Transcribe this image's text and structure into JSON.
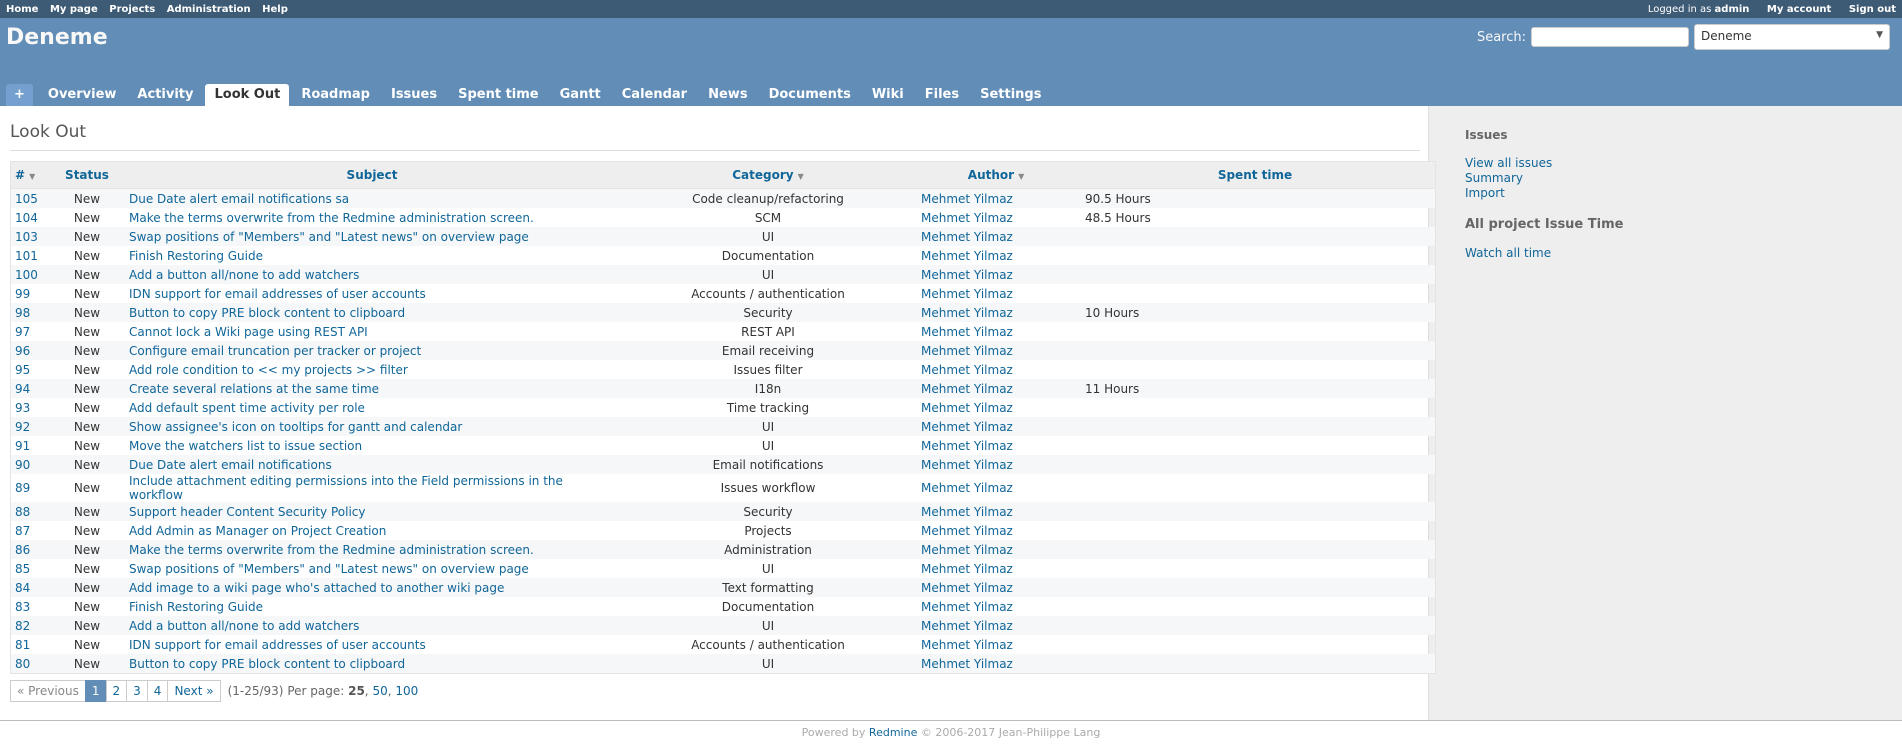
{
  "top_menu": {
    "left": [
      "Home",
      "My page",
      "Projects",
      "Administration",
      "Help"
    ],
    "logged_prefix": "Logged in as",
    "logged_user": "admin",
    "my_account": "My account",
    "sign_out": "Sign out"
  },
  "header": {
    "project_title": "Deneme",
    "search_label": "Search:",
    "search_value": "",
    "project_jump": "Deneme"
  },
  "tabs": [
    "+",
    "Overview",
    "Activity",
    "Look Out",
    "Roadmap",
    "Issues",
    "Spent time",
    "Gantt",
    "Calendar",
    "News",
    "Documents",
    "Wiki",
    "Files",
    "Settings"
  ],
  "selected_tab": "Look Out",
  "page_title": "Look Out",
  "table": {
    "headers": {
      "id": "#",
      "status": "Status",
      "subject": "Subject",
      "category": "Category",
      "author": "Author",
      "spent": "Spent time"
    },
    "rows": [
      {
        "id": "105",
        "status": "New",
        "subject": "Due Date alert email notifications sa",
        "category": "Code cleanup/refactoring",
        "author": "Mehmet Yilmaz",
        "spent": "90.5 Hours"
      },
      {
        "id": "104",
        "status": "New",
        "subject": "Make the terms overwrite from the Redmine administration screen.",
        "category": "SCM",
        "author": "Mehmet Yilmaz",
        "spent": "48.5 Hours"
      },
      {
        "id": "103",
        "status": "New",
        "subject": "Swap positions of \"Members\" and \"Latest news\" on overview page",
        "category": "UI",
        "author": "Mehmet Yilmaz",
        "spent": ""
      },
      {
        "id": "101",
        "status": "New",
        "subject": "Finish Restoring Guide",
        "category": "Documentation",
        "author": "Mehmet Yilmaz",
        "spent": ""
      },
      {
        "id": "100",
        "status": "New",
        "subject": "Add a button all/none to add watchers",
        "category": "UI",
        "author": "Mehmet Yilmaz",
        "spent": ""
      },
      {
        "id": "99",
        "status": "New",
        "subject": "IDN support for email addresses of user accounts",
        "category": "Accounts / authentication",
        "author": "Mehmet Yilmaz",
        "spent": ""
      },
      {
        "id": "98",
        "status": "New",
        "subject": "Button to copy PRE block content to clipboard",
        "category": "Security",
        "author": "Mehmet Yilmaz",
        "spent": "10 Hours"
      },
      {
        "id": "97",
        "status": "New",
        "subject": "Cannot lock a Wiki page using REST API",
        "category": "REST API",
        "author": "Mehmet Yilmaz",
        "spent": ""
      },
      {
        "id": "96",
        "status": "New",
        "subject": "Configure email truncation per tracker or project",
        "category": "Email receiving",
        "author": "Mehmet Yilmaz",
        "spent": ""
      },
      {
        "id": "95",
        "status": "New",
        "subject": "Add role condition to << my projects >> filter",
        "category": "Issues filter",
        "author": "Mehmet Yilmaz",
        "spent": ""
      },
      {
        "id": "94",
        "status": "New",
        "subject": "Create several relations at the same time",
        "category": "I18n",
        "author": "Mehmet Yilmaz",
        "spent": "11 Hours"
      },
      {
        "id": "93",
        "status": "New",
        "subject": "Add default spent time activity per role",
        "category": "Time tracking",
        "author": "Mehmet Yilmaz",
        "spent": ""
      },
      {
        "id": "92",
        "status": "New",
        "subject": "Show assignee's icon on tooltips for gantt and calendar",
        "category": "UI",
        "author": "Mehmet Yilmaz",
        "spent": ""
      },
      {
        "id": "91",
        "status": "New",
        "subject": "Move the watchers list to issue section",
        "category": "UI",
        "author": "Mehmet Yilmaz",
        "spent": ""
      },
      {
        "id": "90",
        "status": "New",
        "subject": "Due Date alert email notifications",
        "category": "Email notifications",
        "author": "Mehmet Yilmaz",
        "spent": ""
      },
      {
        "id": "89",
        "status": "New",
        "subject": "Include attachment editing permissions into the Field permissions in the workflow",
        "category": "Issues workflow",
        "author": "Mehmet Yilmaz",
        "spent": ""
      },
      {
        "id": "88",
        "status": "New",
        "subject": "Support header Content Security Policy",
        "category": "Security",
        "author": "Mehmet Yilmaz",
        "spent": ""
      },
      {
        "id": "87",
        "status": "New",
        "subject": "Add Admin as Manager on Project Creation",
        "category": "Projects",
        "author": "Mehmet Yilmaz",
        "spent": ""
      },
      {
        "id": "86",
        "status": "New",
        "subject": "Make the terms overwrite from the Redmine administration screen.",
        "category": "Administration",
        "author": "Mehmet Yilmaz",
        "spent": ""
      },
      {
        "id": "85",
        "status": "New",
        "subject": "Swap positions of \"Members\" and \"Latest news\" on overview page",
        "category": "UI",
        "author": "Mehmet Yilmaz",
        "spent": ""
      },
      {
        "id": "84",
        "status": "New",
        "subject": "Add image to a wiki page who's attached to another wiki page",
        "category": "Text formatting",
        "author": "Mehmet Yilmaz",
        "spent": ""
      },
      {
        "id": "83",
        "status": "New",
        "subject": "Finish Restoring Guide",
        "category": "Documentation",
        "author": "Mehmet Yilmaz",
        "spent": ""
      },
      {
        "id": "82",
        "status": "New",
        "subject": "Add a button all/none to add watchers",
        "category": "UI",
        "author": "Mehmet Yilmaz",
        "spent": ""
      },
      {
        "id": "81",
        "status": "New",
        "subject": "IDN support for email addresses of user accounts",
        "category": "Accounts / authentication",
        "author": "Mehmet Yilmaz",
        "spent": ""
      },
      {
        "id": "80",
        "status": "New",
        "subject": "Button to copy PRE block content to clipboard",
        "category": "UI",
        "author": "Mehmet Yilmaz",
        "spent": ""
      }
    ]
  },
  "pagination": {
    "prev": "« Previous",
    "pages": [
      "1",
      "2",
      "3",
      "4"
    ],
    "current": "1",
    "next": "Next »",
    "range": "(1-25/93)",
    "per_page_label": "Per page:",
    "per_page_current": "25",
    "per_page_options": [
      "50",
      "100"
    ]
  },
  "sidebar": {
    "issues_title": "Issues",
    "issues_links": [
      "View all issues",
      "Summary",
      "Import"
    ],
    "time_title": "All project Issue Time",
    "time_links": [
      "Watch all time"
    ]
  },
  "footer": {
    "prefix": "Powered by",
    "link": "Redmine",
    "suffix": "© 2006-2017 Jean-Philippe Lang"
  },
  "colors": {
    "top_bar": "#3e5b76",
    "header": "#628db6",
    "link": "#116699",
    "sidebar": "#eeeeee"
  }
}
